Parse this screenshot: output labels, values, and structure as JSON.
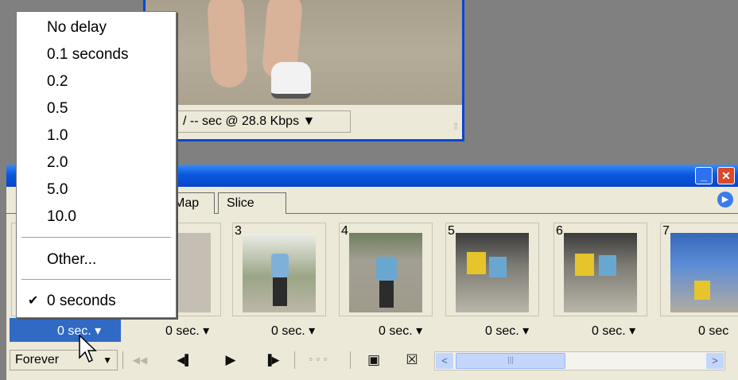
{
  "image_window": {
    "status_text": "/ -- sec @ 28.8 Kbps ▼",
    "grip": "⁞⁞"
  },
  "animation_panel": {
    "title_buttons": {
      "minimize": "_",
      "close": "✕"
    },
    "tabs": [
      "Map",
      "Slice"
    ],
    "palette_menu": "▶",
    "frames": [
      {
        "number": "",
        "delay": "0 sec. ▾",
        "selected": true
      },
      {
        "number": "",
        "delay": "0 sec. ▾",
        "selected": false
      },
      {
        "number": "3",
        "delay": "0 sec. ▾",
        "selected": false
      },
      {
        "number": "4",
        "delay": "0 sec. ▾",
        "selected": false
      },
      {
        "number": "5",
        "delay": "0 sec. ▾",
        "selected": false
      },
      {
        "number": "6",
        "delay": "0 sec. ▾",
        "selected": false
      },
      {
        "number": "7",
        "delay": "0 sec",
        "selected": false
      }
    ],
    "toolbar": {
      "loop_value": "Forever",
      "loop_caret": "▼",
      "first_frame": "◀◀",
      "prev_frame": "◀▌",
      "play": "▶",
      "next_frame": "▐▶",
      "tween": "⚬⚬⚬",
      "duplicate": "▣",
      "delete": "☒",
      "scroll_left": "<",
      "scroll_right": ">",
      "scroll_thumb": "|||"
    }
  },
  "delay_menu": {
    "items": [
      "No delay",
      "0.1 seconds",
      "0.2",
      "0.5",
      "1.0",
      "2.0",
      "5.0",
      "10.0"
    ],
    "other": "Other...",
    "current": "0 seconds",
    "check": "✔"
  },
  "colors": {
    "title_blue": "#0a58e0",
    "selection_blue": "#316ac5",
    "panel_bg": "#ece9d8",
    "desktop_gray": "#808080"
  }
}
